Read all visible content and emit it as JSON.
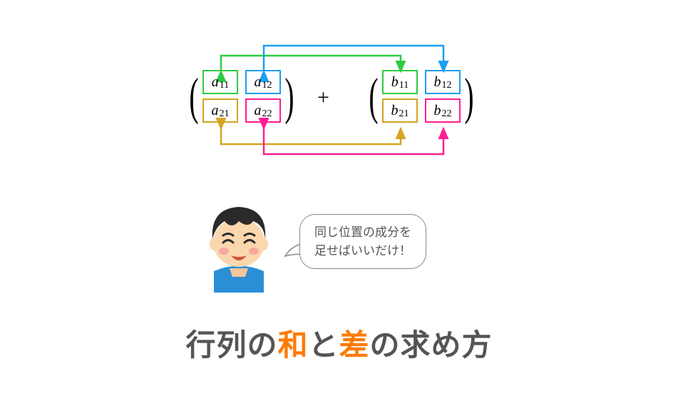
{
  "matrix_a": {
    "r1c1": {
      "base": "a",
      "sub": "11"
    },
    "r1c2": {
      "base": "a",
      "sub": "12"
    },
    "r2c1": {
      "base": "a",
      "sub": "21"
    },
    "r2c2": {
      "base": "a",
      "sub": "22"
    }
  },
  "matrix_b": {
    "r1c1": {
      "base": "b",
      "sub": "11"
    },
    "r1c2": {
      "base": "b",
      "sub": "12"
    },
    "r2c1": {
      "base": "b",
      "sub": "21"
    },
    "r2c2": {
      "base": "b",
      "sub": "22"
    }
  },
  "operator": "+",
  "speech": {
    "line1": "同じ位置の成分を",
    "line2": "足せばいいだけ！"
  },
  "title": {
    "t1": "行列の",
    "t2": "和",
    "t3": "と",
    "t4": "差",
    "t5": "の求め方"
  },
  "colors": {
    "c11": "#2ecc40",
    "c12": "#1e9ef0",
    "c21": "#d4a520",
    "c22": "#ff1e90"
  }
}
